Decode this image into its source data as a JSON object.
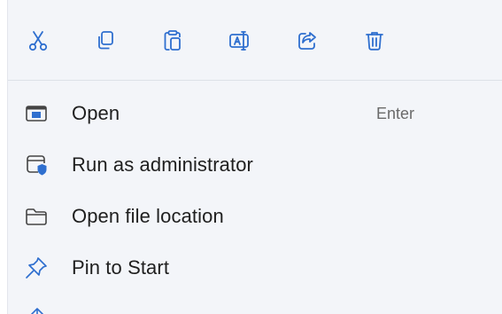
{
  "colors": {
    "accent": "#2f6fcf",
    "menu_bg": "#f3f5f9",
    "text": "#1f1f1f",
    "shortcut_text": "#6a6a6a",
    "divider": "#dde1e8"
  },
  "toolbar": {
    "icons": [
      "cut-icon",
      "copy-icon",
      "paste-icon",
      "rename-icon",
      "share-icon",
      "delete-icon"
    ]
  },
  "menu": {
    "items": [
      {
        "label": "Open",
        "shortcut": "Enter",
        "icon": "open-window-icon"
      },
      {
        "label": "Run as administrator",
        "shortcut": "",
        "icon": "shield-window-icon"
      },
      {
        "label": "Open file location",
        "shortcut": "",
        "icon": "folder-icon"
      },
      {
        "label": "Pin to Start",
        "shortcut": "",
        "icon": "pin-icon"
      }
    ]
  }
}
